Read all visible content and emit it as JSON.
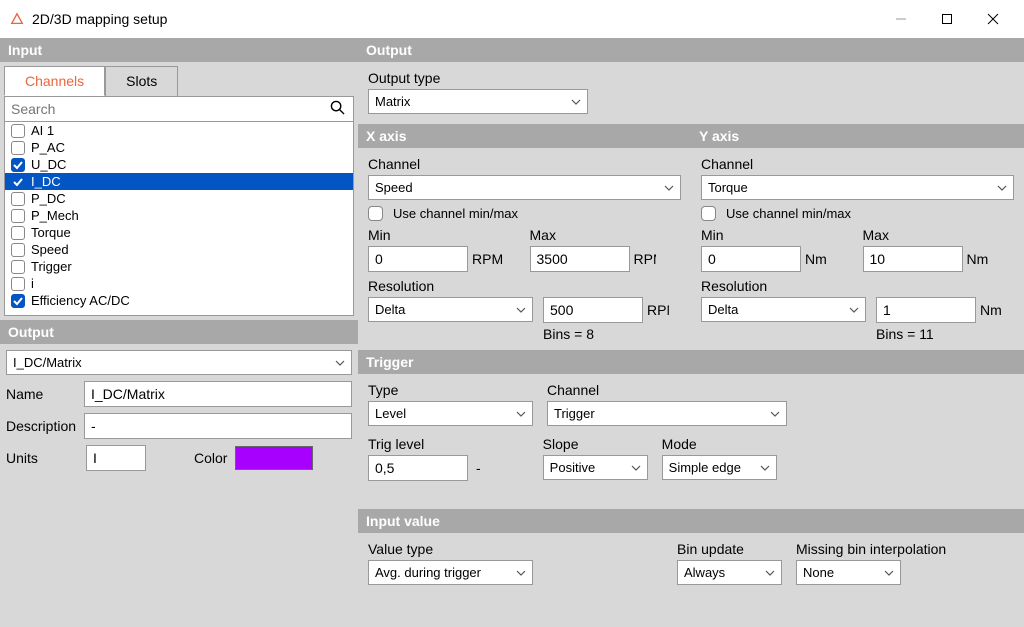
{
  "window": {
    "title": "2D/3D mapping setup"
  },
  "input": {
    "header": "Input",
    "tabs": {
      "channels": "Channels",
      "slots": "Slots"
    },
    "search_placeholder": "Search",
    "channels": [
      {
        "label": "AI 1",
        "checked": false,
        "selected": false
      },
      {
        "label": "P_AC",
        "checked": false,
        "selected": false
      },
      {
        "label": "U_DC",
        "checked": true,
        "selected": false
      },
      {
        "label": "I_DC",
        "checked": true,
        "selected": true
      },
      {
        "label": "P_DC",
        "checked": false,
        "selected": false
      },
      {
        "label": "P_Mech",
        "checked": false,
        "selected": false
      },
      {
        "label": "Torque",
        "checked": false,
        "selected": false
      },
      {
        "label": "Speed",
        "checked": false,
        "selected": false
      },
      {
        "label": "Trigger",
        "checked": false,
        "selected": false
      },
      {
        "label": "i",
        "checked": false,
        "selected": false
      },
      {
        "label": "Efficiency AC/DC",
        "checked": true,
        "selected": false
      }
    ]
  },
  "output_panel": {
    "header": "Output",
    "selected": "I_DC/Matrix",
    "name_label": "Name",
    "name_value": "I_DC/Matrix",
    "desc_label": "Description",
    "desc_value": "-",
    "units_label": "Units",
    "units_value": "I",
    "color_label": "Color",
    "color_value": "#a700ff"
  },
  "output": {
    "header": "Output",
    "type_label": "Output type",
    "type_value": "Matrix"
  },
  "x_axis": {
    "header": "X axis",
    "channel_label": "Channel",
    "channel_value": "Speed",
    "use_minmax": "Use channel min/max",
    "min_label": "Min",
    "min_value": "0",
    "min_unit": "RPM",
    "max_label": "Max",
    "max_value": "3500",
    "max_unit": "RPM",
    "res_label": "Resolution",
    "res_type": "Delta",
    "res_value": "500",
    "res_unit": "RPM",
    "bins": "Bins = 8"
  },
  "y_axis": {
    "header": "Y axis",
    "channel_label": "Channel",
    "channel_value": "Torque",
    "use_minmax": "Use channel min/max",
    "min_label": "Min",
    "min_value": "0",
    "min_unit": "Nm",
    "max_label": "Max",
    "max_value": "10",
    "max_unit": "Nm",
    "res_label": "Resolution",
    "res_type": "Delta",
    "res_value": "1",
    "res_unit": "Nm",
    "bins": "Bins = 11"
  },
  "trigger": {
    "header": "Trigger",
    "type_label": "Type",
    "type_value": "Level",
    "channel_label": "Channel",
    "channel_value": "Trigger",
    "level_label": "Trig level",
    "level_value": "0,5",
    "level_unit": "-",
    "slope_label": "Slope",
    "slope_value": "Positive",
    "mode_label": "Mode",
    "mode_value": "Simple edge"
  },
  "input_value": {
    "header": "Input value",
    "value_type_label": "Value type",
    "value_type_value": "Avg. during trigger",
    "bin_update_label": "Bin update",
    "bin_update_value": "Always",
    "missing_label": "Missing bin interpolation",
    "missing_value": "None"
  }
}
